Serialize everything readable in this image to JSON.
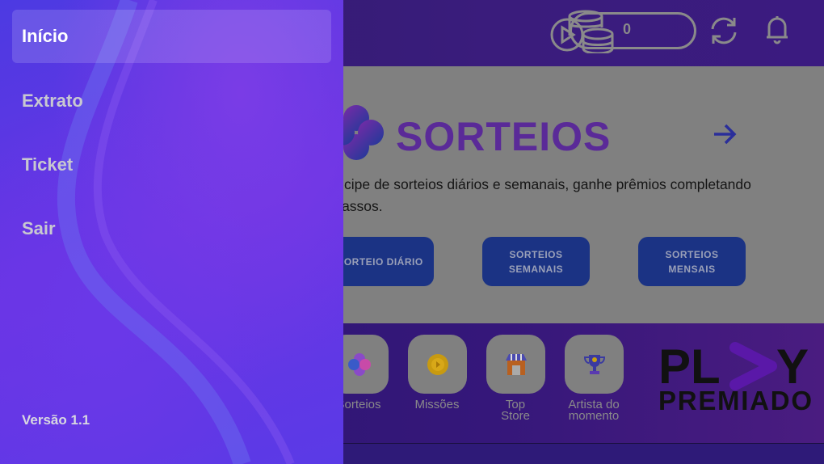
{
  "header": {
    "balance": "0",
    "icons": [
      "coins-play-icon",
      "refresh-icon",
      "bell-icon"
    ]
  },
  "sorteios": {
    "title": "SORTEIOS",
    "description": "Participe de sorteios diários e semanais, ganhe prêmios completando os passos.",
    "buttons": [
      {
        "label": "SORTEIO DIÁRIO"
      },
      {
        "label": "SORTEIOS SEMANAIS"
      },
      {
        "label": "SORTEIOS MENSAIS"
      }
    ]
  },
  "shortcuts": [
    {
      "label": "Sorteios",
      "icon": "clover-icon"
    },
    {
      "label": "Missões",
      "icon": "coin-icon"
    },
    {
      "label": "Top Store",
      "icon": "store-icon"
    },
    {
      "label": "Artista do momento",
      "icon": "trophy-icon"
    }
  ],
  "logo": {
    "line1": "PLAY",
    "line2": "PREMIADO"
  },
  "sidebar": {
    "items": [
      {
        "label": "Início",
        "active": true
      },
      {
        "label": "Extrato",
        "active": false
      },
      {
        "label": "Ticket",
        "active": false
      },
      {
        "label": "Sair",
        "active": false
      }
    ],
    "version": "Versão 1.1"
  },
  "colors": {
    "title": "#5a2a98",
    "button": "#1b3384",
    "sidebar": "#5a3ae6"
  }
}
